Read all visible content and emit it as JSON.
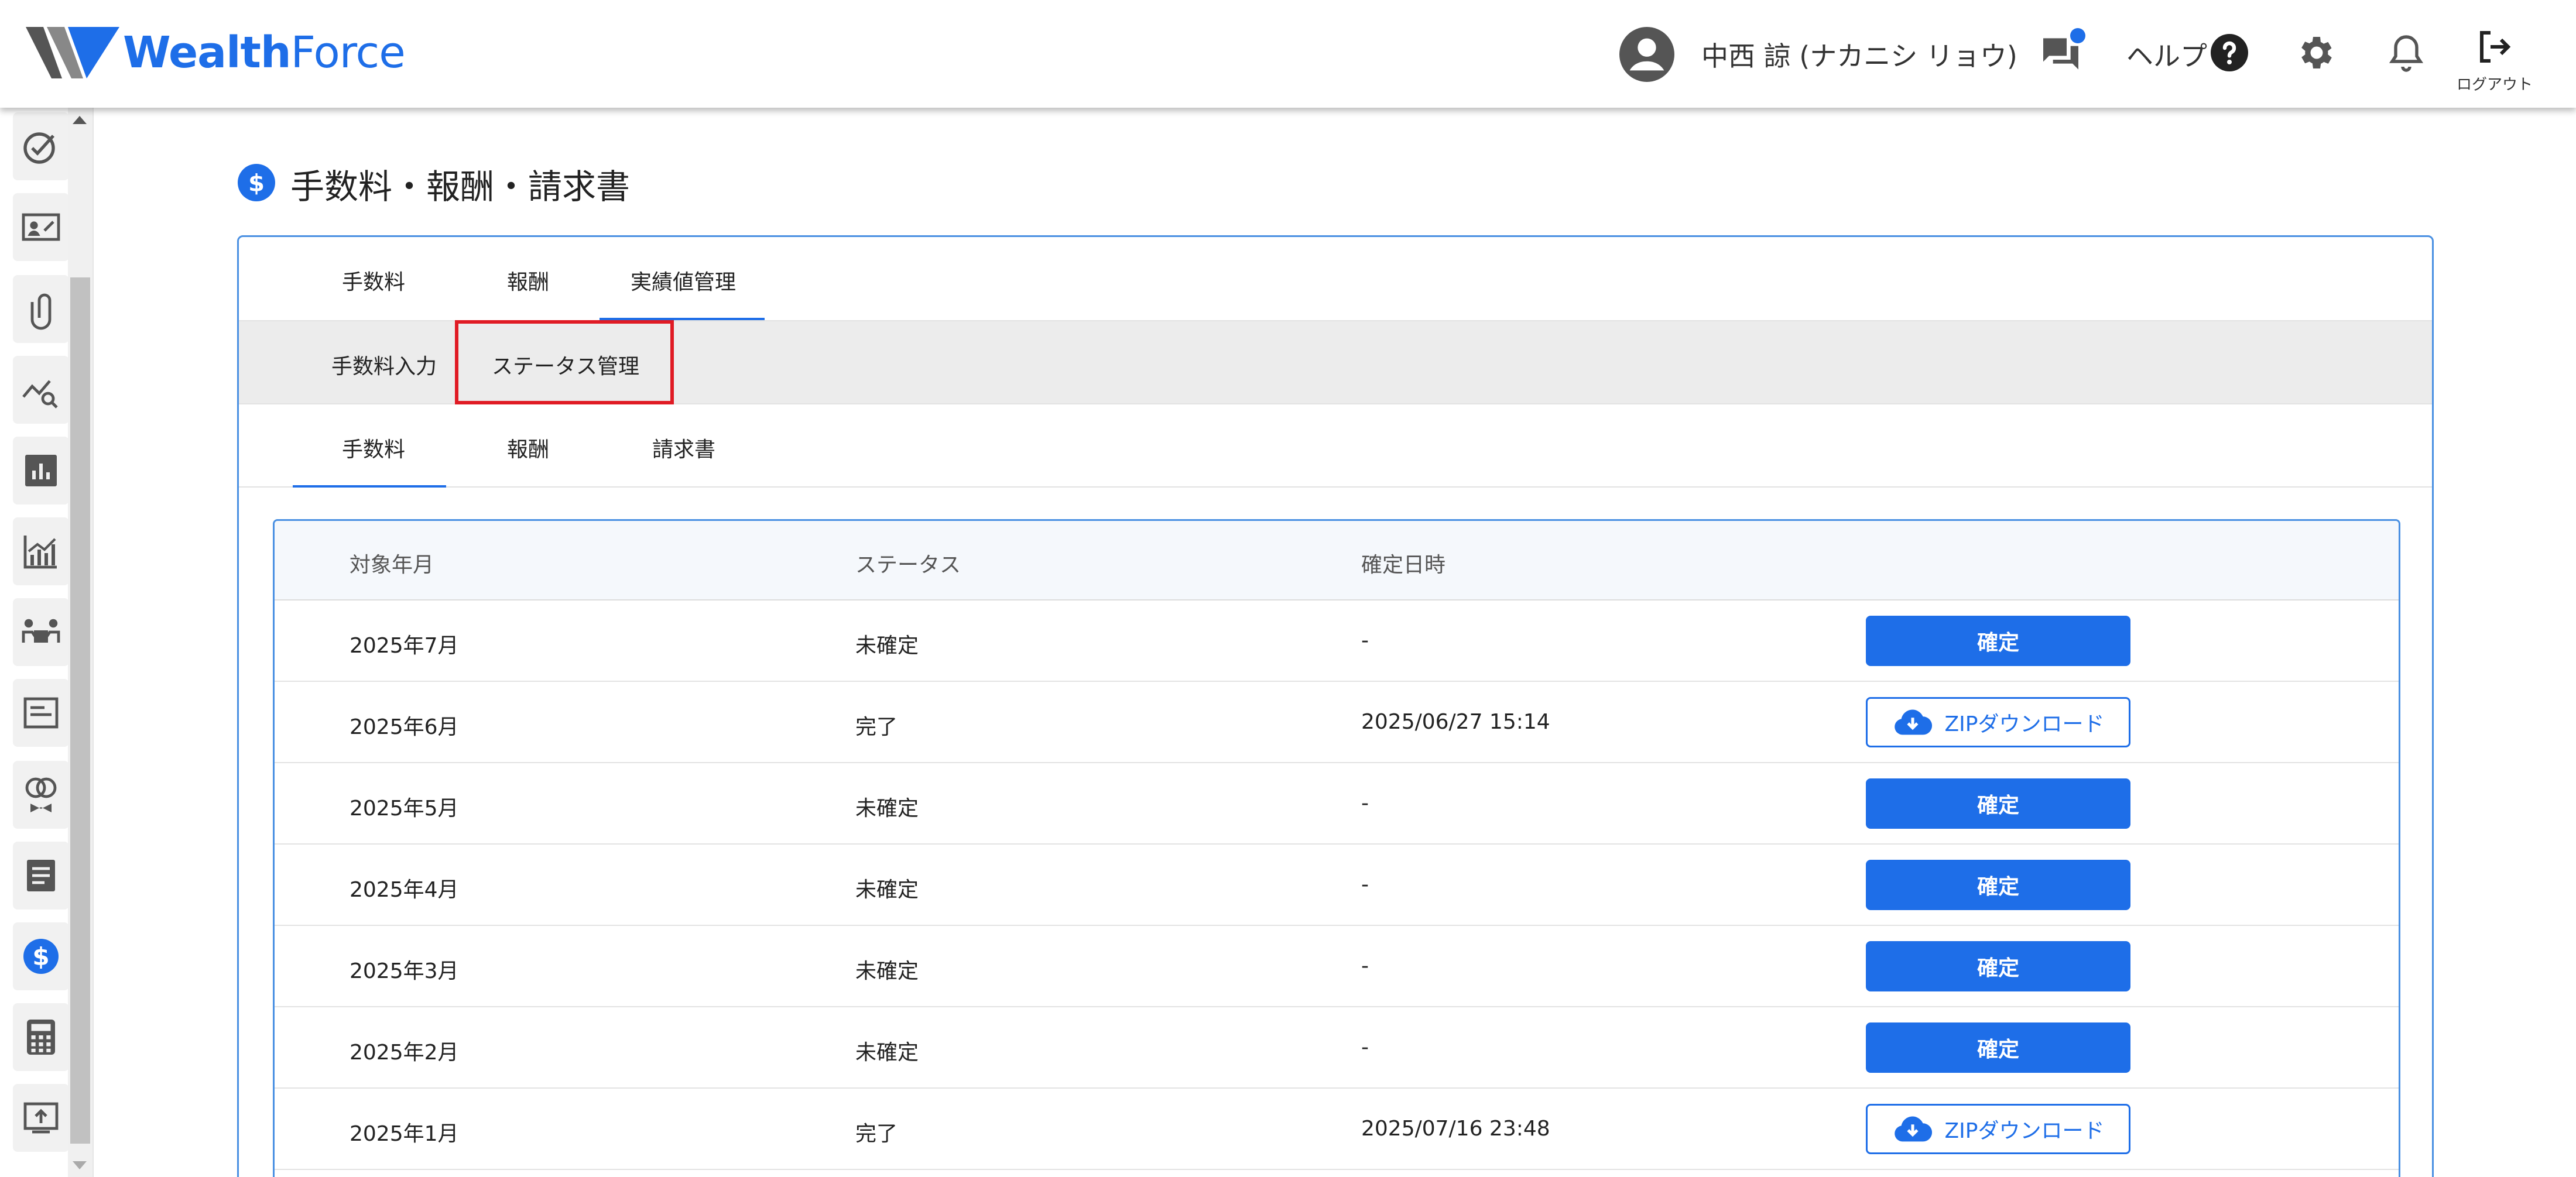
{
  "app": {
    "logo_text_bold": "Wealth",
    "logo_text_light": "Force"
  },
  "header": {
    "user_name": "中西 諒 (ナカニシ リョウ)",
    "help_label": "ヘルプ",
    "logout_label": "ログアウト"
  },
  "colors": {
    "brand": "#1e6ee8",
    "highlight": "#e01b24"
  },
  "sidebar": {
    "icons": [
      "check-circle-icon",
      "id-card-icon",
      "paperclip-icon",
      "trend-search-icon",
      "bar-chart-icon",
      "growth-chart-icon",
      "meeting-icon",
      "document-card-icon",
      "rings-icon",
      "notes-icon",
      "dollar-icon",
      "calculator-icon",
      "upload-screen-icon"
    ]
  },
  "page": {
    "title": "手数料・報酬・請求書"
  },
  "tabs_primary": [
    "手数料",
    "報酬",
    "実績値管理"
  ],
  "tabs_secondary": [
    "手数料入力",
    "ステータス管理"
  ],
  "tabs_tertiary": [
    "手数料",
    "報酬",
    "請求書"
  ],
  "table": {
    "headers": [
      "対象年月",
      "ステータス",
      "確定日時",
      ""
    ],
    "rows": [
      {
        "month": "2025年7月",
        "status": "未確定",
        "confirmed_at": "-",
        "action": "確定",
        "action_type": "confirm"
      },
      {
        "month": "2025年6月",
        "status": "完了",
        "confirmed_at": "2025/06/27 15:14",
        "action": "ZIPダウンロード",
        "action_type": "zip"
      },
      {
        "month": "2025年5月",
        "status": "未確定",
        "confirmed_at": "-",
        "action": "確定",
        "action_type": "confirm"
      },
      {
        "month": "2025年4月",
        "status": "未確定",
        "confirmed_at": "-",
        "action": "確定",
        "action_type": "confirm"
      },
      {
        "month": "2025年3月",
        "status": "未確定",
        "confirmed_at": "-",
        "action": "確定",
        "action_type": "confirm"
      },
      {
        "month": "2025年2月",
        "status": "未確定",
        "confirmed_at": "-",
        "action": "確定",
        "action_type": "confirm"
      },
      {
        "month": "2025年1月",
        "status": "完了",
        "confirmed_at": "2025/07/16 23:48",
        "action": "ZIPダウンロード",
        "action_type": "zip"
      }
    ]
  }
}
